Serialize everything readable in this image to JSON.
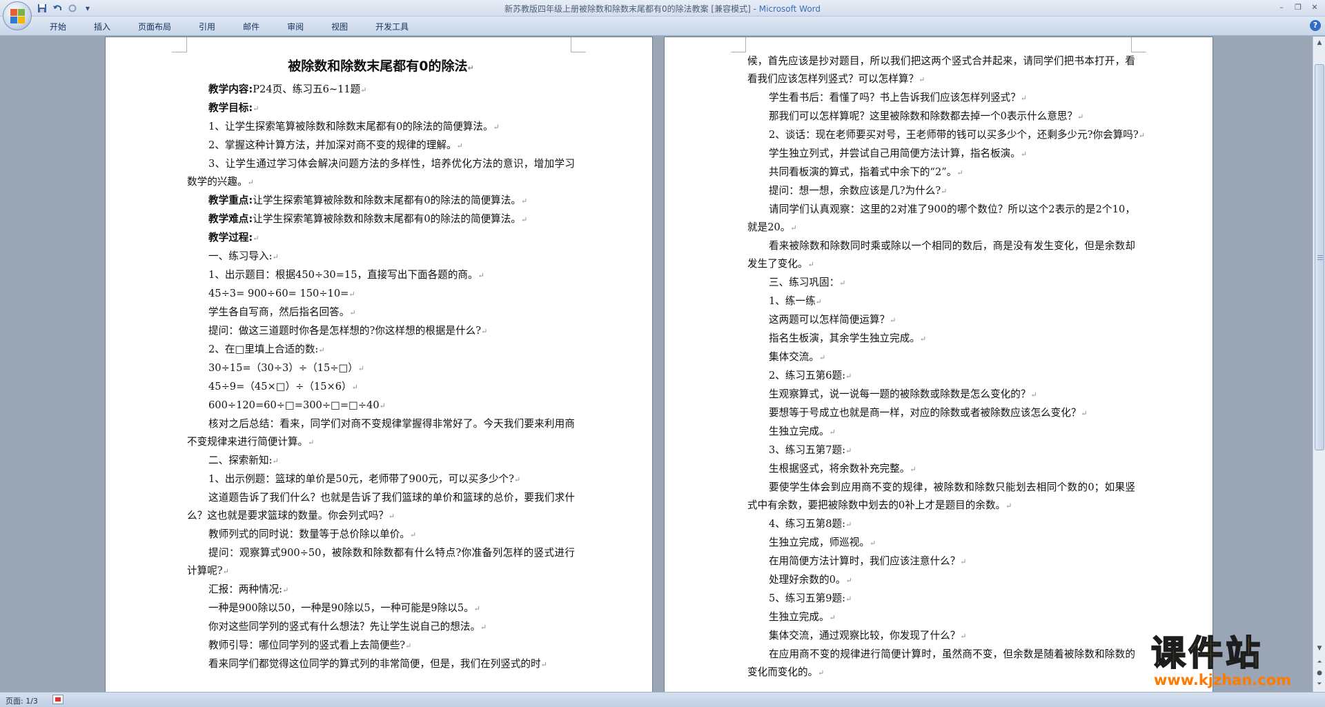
{
  "window": {
    "title": "新苏教版四年级上册被除数和除数末尾都有0的除法教案 [兼容模式]",
    "app_name": "- Microsoft Word"
  },
  "quick_access": {
    "save_icon": "save-icon",
    "undo_icon": "undo-icon",
    "redo_icon": "redo-icon",
    "customize_icon": "dropdown-arrow-icon"
  },
  "window_controls": {
    "minimize": "–",
    "restore": "❐",
    "close": "✕"
  },
  "ribbon": {
    "tabs": [
      "开始",
      "插入",
      "页面布局",
      "引用",
      "邮件",
      "审阅",
      "视图",
      "开发工具"
    ],
    "help": "?"
  },
  "document": {
    "left_page": {
      "title": "被除数和除数末尾都有0的除法",
      "lines": [
        {
          "bold": "教学内容:",
          "text": "P24页、练习五6~11题"
        },
        {
          "bold": "教学目标:",
          "text": ""
        },
        {
          "bold": "",
          "text": "1、让学生探索笔算被除数和除数末尾都有0的除法的简便算法。"
        },
        {
          "bold": "",
          "text": "2、掌握这种计算方法，并加深对商不变的规律的理解。"
        },
        {
          "bold": "",
          "text": "3、让学生通过学习体会解决问题方法的多样性，培养优化方法的意识，增加学习数学的兴趣。"
        },
        {
          "bold": "教学重点:",
          "text": "让学生探索笔算被除数和除数末尾都有0的除法的简便算法。"
        },
        {
          "bold": "教学难点:",
          "text": "让学生探索笔算被除数和除数末尾都有0的除法的简便算法。"
        },
        {
          "bold": "教学过程:",
          "text": ""
        },
        {
          "bold": "",
          "text": "一、练习导入:"
        },
        {
          "bold": "",
          "text": "1、出示题目：根据450÷30=15，直接写出下面各题的商。"
        },
        {
          "bold": "",
          "text": "45÷3=            900÷60=            150÷10="
        },
        {
          "bold": "",
          "text": "学生各自写商，然后指名回答。"
        },
        {
          "bold": "",
          "text": "提问：做这三道题时你各是怎样想的?你这样想的根据是什么?"
        },
        {
          "bold": "",
          "text": "2、在□里填上合适的数:"
        },
        {
          "bold": "",
          "text": "30÷15=（30÷3）÷（15÷□）"
        },
        {
          "bold": "",
          "text": "45÷9=（45×□）÷（15×6）"
        },
        {
          "bold": "",
          "text": "600÷120=60÷□=300÷□=□÷40"
        },
        {
          "bold": "",
          "text": "核对之后总结：看来，同学们对商不变规律掌握得非常好了。今天我们要来利用商不变规律来进行简便计算。"
        },
        {
          "bold": "",
          "text": "二、探索新知:"
        },
        {
          "bold": "",
          "text": "1、出示例题：篮球的单价是50元，老师带了900元，可以买多少个?"
        },
        {
          "bold": "",
          "text": "这道题告诉了我们什么？也就是告诉了我们篮球的单价和篮球的总价，要我们求什么？这也就是要求篮球的数量。你会列式吗？"
        },
        {
          "bold": "",
          "text": "教师列式的同时说：数量等于总价除以单价。"
        },
        {
          "bold": "",
          "text": "提问：观察算式900÷50，被除数和除数都有什么特点?你准备列怎样的竖式进行计算呢?"
        },
        {
          "bold": "",
          "text": "汇报：两种情况:"
        },
        {
          "bold": "",
          "text": "一种是900除以50，一种是90除以5，一种可能是9除以5。"
        },
        {
          "bold": "",
          "text": "你对这些同学列的竖式有什么想法？先让学生说自己的想法。"
        },
        {
          "bold": "",
          "text": "教师引导：哪位同学列的竖式看上去简便些?"
        },
        {
          "bold": "",
          "text": "看来同学们都觉得这位同学的算式列的非常简便，但是，我们在列竖式的时"
        }
      ]
    },
    "right_page": {
      "lines": [
        "候，首先应该是抄对题目，所以我们把这两个竖式合并起来，请同学们把书本打开，看看我们应该怎样列竖式？可以怎样算？",
        "学生看书后：看懂了吗？书上告诉我们应该怎样列竖式？",
        "那我们可以怎样算呢？这里被除数和除数都去掉一个0表示什么意思？",
        "2、谈话：现在老师要买对号，王老师带的钱可以买多少个，还剩多少元?你会算吗?",
        "学生独立列式，并尝试自己用简便方法计算，指名板演。",
        "共同看板演的算式，指着式中余下的“2”。",
        "提问：想一想，余数应该是几?为什么?",
        "请同学们认真观察：这里的2对准了900的哪个数位？所以这个2表示的是2个10，就是20。",
        "看来被除数和除数同时乘或除以一个相同的数后，商是没有发生变化，但是余数却发生了变化。",
        "三、练习巩固：",
        "1、练一练",
        "这两题可以怎样简便运算？",
        "指名生板演，其余学生独立完成。",
        "集体交流。",
        "2、练习五第6题:",
        "生观察算式，说一说每一题的被除数或除数是怎么变化的？",
        "要想等于号成立也就是商一样，对应的除数或者被除数应该怎么变化？",
        "生独立完成。",
        "3、练习五第7题:",
        "生根据竖式，将余数补充完整。",
        "要使学生体会到应用商不变的规律，被除数和除数只能划去相同个数的0；如果竖式中有余数，要把被除数中划去的0补上才是题目的余数。",
        "4、练习五第8题:",
        "生独立完成，师巡视。",
        "在用简便方法计算时，我们应该注意什么？",
        "处理好余数的0。",
        "5、练习五第9题:",
        "生独立完成。",
        "集体交流，通过观察比较，你发现了什么？",
        "在应用商不变的规律进行简便计算时，虽然商不变，但余数是随着被除数和除数的变化而变化的。"
      ]
    }
  },
  "status": {
    "page": "页面: 1/3"
  },
  "watermark": {
    "main": "课件站",
    "url": "www.kjzhan.com"
  }
}
